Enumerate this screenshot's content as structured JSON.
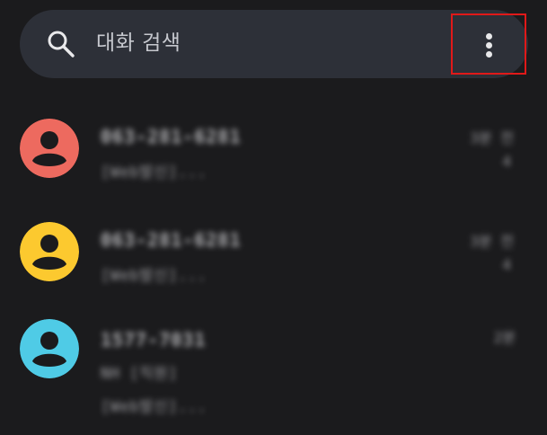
{
  "search": {
    "placeholder": "대화 검색",
    "icon": "search-icon"
  },
  "menu": {
    "icon": "more-vert-icon",
    "highlight_color": "#e01919"
  },
  "conversations": [
    {
      "avatar_color": "#ed6a5f",
      "name": "063-281-6281",
      "preview": "[Web발신]...",
      "time": "3분 전",
      "count": "4"
    },
    {
      "avatar_color": "#fcc92f",
      "name": "063-281-6281",
      "preview": "[Web발신]...",
      "time": "3분 전",
      "count": "4"
    },
    {
      "avatar_color": "#4fcbe6",
      "name": "1577-7031",
      "preview": "NH [직원]",
      "preview2": "[Web발신]...",
      "time": "2분"
    }
  ]
}
